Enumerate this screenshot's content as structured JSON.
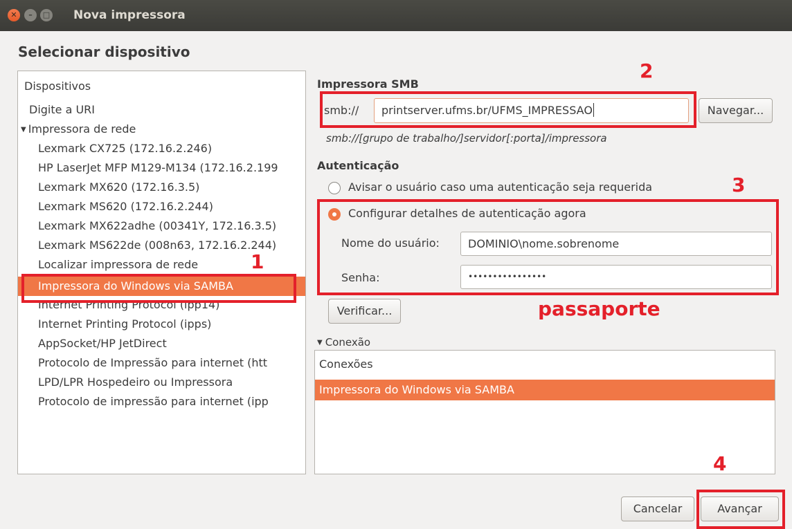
{
  "window": {
    "title": "Nova impressora"
  },
  "heading": "Selecionar dispositivo",
  "devices": {
    "header": "Dispositivos",
    "items": [
      "Digite a URI",
      "Impressora de rede",
      "Lexmark CX725 (172.16.2.246)",
      "HP LaserJet MFP M129-M134 (172.16.2.199",
      "Lexmark MX620 (172.16.3.5)",
      "Lexmark MS620 (172.16.2.244)",
      "Lexmark MX622adhe (00341Y, 172.16.3.5)",
      "Lexmark MS622de (008n63, 172.16.2.244)",
      "Localizar impressora de rede",
      "Impressora do Windows via SAMBA",
      "Internet Printing Protocol (ipp14)",
      "Internet Printing Protocol (ipps)",
      "AppSocket/HP JetDirect",
      "Protocolo de Impressão para internet (htt",
      "LPD/LPR Hospedeiro ou Impressora",
      "Protocolo de impressão para internet (ipp"
    ],
    "selected": "Impressora do Windows via SAMBA"
  },
  "smb": {
    "section_label": "Impressora SMB",
    "prefix": "smb://",
    "value": "printserver.ufms.br/UFMS_IMPRESSAO",
    "browse_label": "Navegar...",
    "hint": "smb://[grupo de trabalho/]servidor[:porta]/impressora"
  },
  "auth": {
    "section_label": "Autenticação",
    "option_prompt": "Avisar o usuário caso uma autenticação seja requerida",
    "option_now": "Configurar detalhes de autenticação agora",
    "selected_option": "Configurar detalhes de autenticação agora",
    "username_label": "Nome do usuário:",
    "username_value": "DOMINIO\\nome.sobrenome",
    "password_label": "Senha:",
    "password_value": "••••••••••••••••",
    "verify_label": "Verificar..."
  },
  "connection": {
    "section_label": "Conexão",
    "header": "Conexões",
    "selected": "Impressora do Windows via SAMBA"
  },
  "buttons": {
    "cancel": "Cancelar",
    "next": "Avançar"
  },
  "annotations": {
    "step1": "1",
    "step2": "2",
    "step3": "3",
    "step4": "4",
    "note": "passaporte",
    "color": "#e4202a"
  },
  "colors": {
    "accent": "#f07746",
    "titlebar": "#3b3b37",
    "background": "#f2f1f0"
  }
}
